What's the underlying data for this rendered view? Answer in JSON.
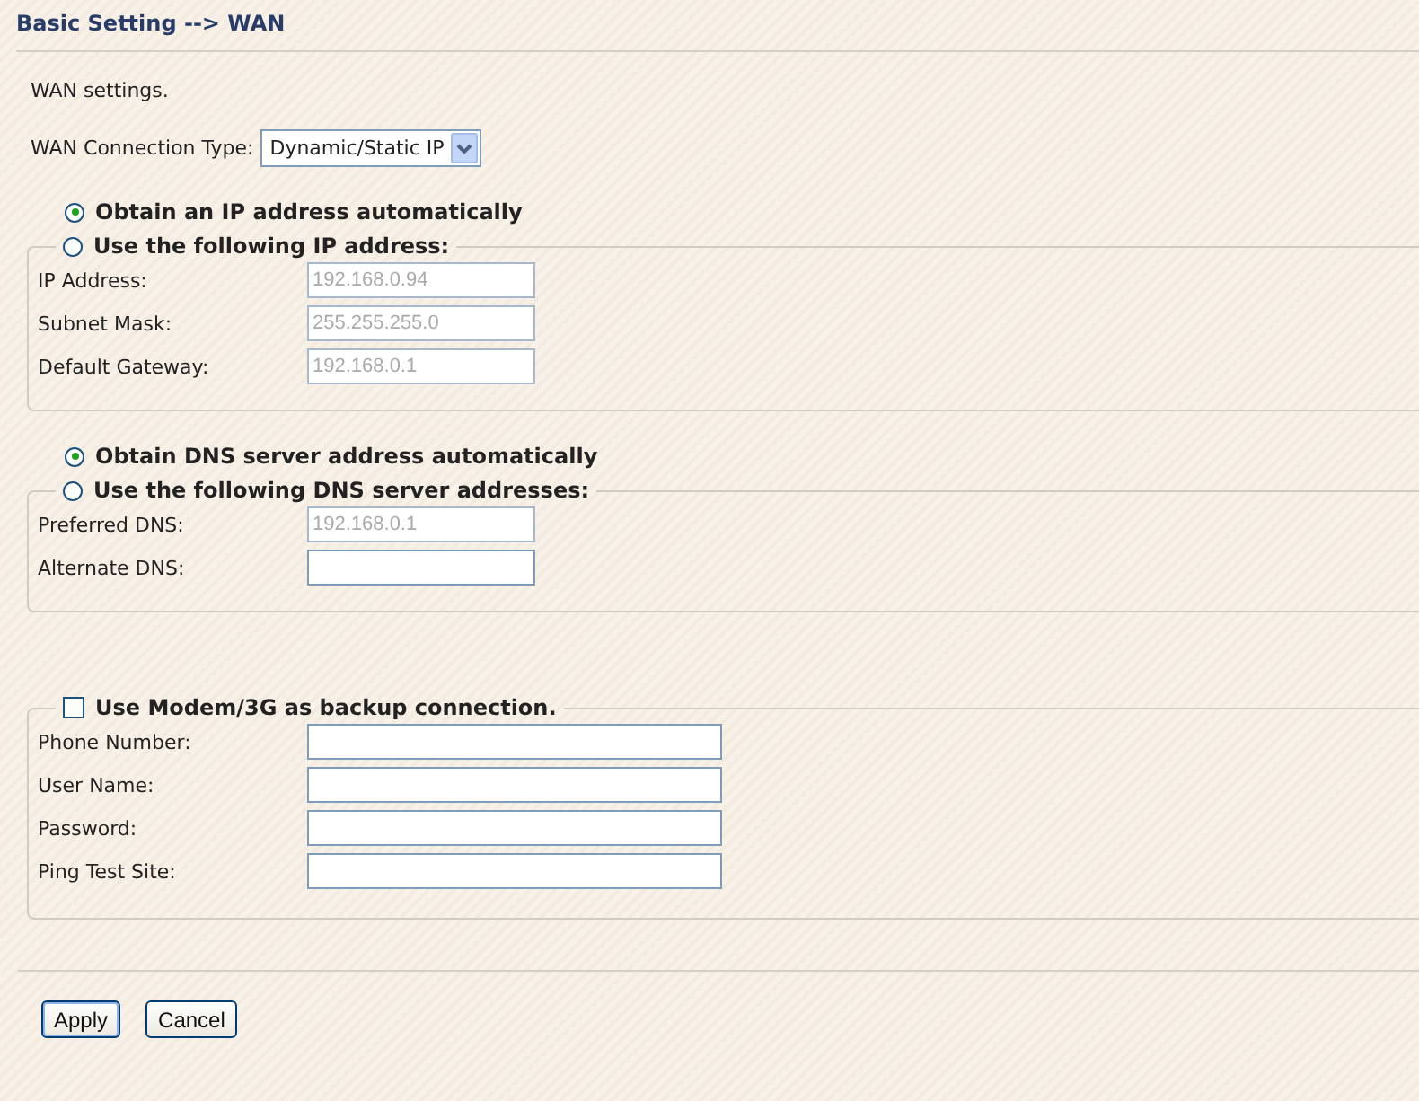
{
  "title": "Basic Setting --> WAN",
  "intro": "WAN settings.",
  "connection_type": {
    "label": "WAN Connection Type:",
    "value": "Dynamic/Static IP"
  },
  "ip_group": {
    "auto_option": {
      "label": "Obtain an IP address automatically",
      "selected": true
    },
    "manual_option": {
      "label": "Use the following IP address:",
      "selected": false
    },
    "fields": [
      {
        "label": "IP Address:",
        "value": "192.168.0.94",
        "disabled": true
      },
      {
        "label": "Subnet Mask:",
        "value": "255.255.255.0",
        "disabled": true
      },
      {
        "label": "Default Gateway:",
        "value": "192.168.0.1",
        "disabled": true
      }
    ]
  },
  "dns_group": {
    "auto_option": {
      "label": "Obtain DNS server address automatically",
      "selected": true
    },
    "manual_option": {
      "label": "Use the following DNS server addresses:",
      "selected": false
    },
    "fields": [
      {
        "label": "Preferred DNS:",
        "value": "192.168.0.1",
        "disabled": true
      },
      {
        "label": "Alternate DNS:",
        "disabled": false
      }
    ]
  },
  "backup_group": {
    "label": "Use Modem/3G as backup connection.",
    "checked": false,
    "fields": [
      {
        "label": "Phone Number:",
        "disabled": false
      },
      {
        "label": "User Name:",
        "disabled": false
      },
      {
        "label": "Password:",
        "disabled": false
      },
      {
        "label": "Ping Test Site:",
        "disabled": false
      }
    ]
  },
  "buttons": [
    {
      "label": "Apply",
      "default": true
    },
    {
      "label": "Cancel",
      "default": false
    }
  ]
}
